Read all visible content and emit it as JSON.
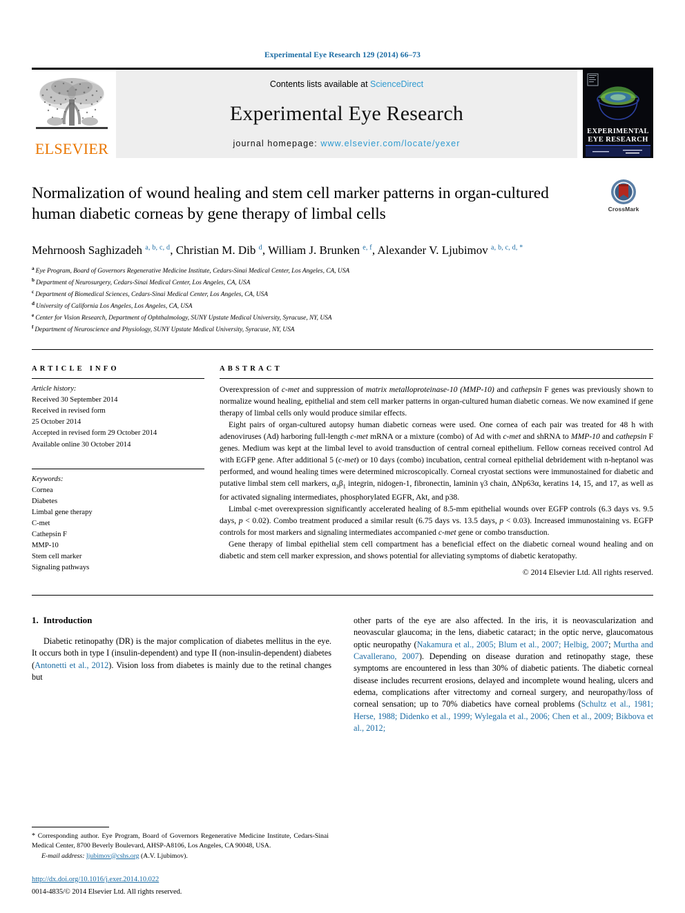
{
  "running_head": "Experimental Eye Research 129 (2014) 66–73",
  "masthead": {
    "elsevier_wordmark": "ELSEVIER",
    "contents_prefix": "Contents lists available at ",
    "contents_link": "ScienceDirect",
    "journal_name": "Experimental Eye Research",
    "homepage_prefix": "journal homepage: ",
    "homepage_url": "www.elsevier.com/locate/yexer",
    "cover_title_line1": "EXPERIMENTAL",
    "cover_title_line2": "EYE RESEARCH"
  },
  "crossmark": {
    "label": "CrossMark"
  },
  "title": "Normalization of wound healing and stem cell marker patterns in organ-cultured human diabetic corneas by gene therapy of limbal cells",
  "authors": [
    {
      "name": "Mehrnoosh Saghizadeh",
      "marks": "a, b, c, d",
      "sep": ", "
    },
    {
      "name": "Christian M. Dib",
      "marks": "d",
      "sep": ", "
    },
    {
      "name": "William J. Brunken",
      "marks": "e, f",
      "sep": ", "
    },
    {
      "name": "Alexander V. Ljubimov",
      "marks": "a, b, c, d,",
      "sep": "",
      "corresponding": "*"
    }
  ],
  "affiliations": [
    {
      "mark": "a",
      "text": "Eye Program, Board of Governors Regenerative Medicine Institute, Cedars-Sinai Medical Center, Los Angeles, CA, USA"
    },
    {
      "mark": "b",
      "text": "Department of Neurosurgery, Cedars-Sinai Medical Center, Los Angeles, CA, USA"
    },
    {
      "mark": "c",
      "text": "Department of Biomedical Sciences, Cedars-Sinai Medical Center, Los Angeles, CA, USA"
    },
    {
      "mark": "d",
      "text": "University of California Los Angeles, Los Angeles, CA, USA"
    },
    {
      "mark": "e",
      "text": "Center for Vision Research, Department of Ophthalmology, SUNY Upstate Medical University, Syracuse, NY, USA"
    },
    {
      "mark": "f",
      "text": "Department of Neuroscience and Physiology, SUNY Upstate Medical University, Syracuse, NY, USA"
    }
  ],
  "article_info": {
    "heading": "ARTICLE INFO",
    "history_title": "Article history:",
    "history": [
      "Received 30 September 2014",
      "Received in revised form",
      "25 October 2014",
      "Accepted in revised form 29 October 2014",
      "Available online 30 October 2014"
    ],
    "keywords_title": "Keywords:",
    "keywords": [
      "Cornea",
      "Diabetes",
      "Limbal gene therapy",
      "C-met",
      "Cathepsin F",
      "MMP-10",
      "Stem cell marker",
      "Signaling pathways"
    ]
  },
  "abstract": {
    "heading": "ABSTRACT",
    "paragraphs": [
      "Overexpression of <i class=\"it\">c-met</i> and suppression of <i class=\"it\">matrix metalloproteinase-10 (MMP-10)</i> and <i class=\"it\">cathepsin</i> F genes was previously shown to normalize wound healing, epithelial and stem cell marker patterns in organ-cultured human diabetic corneas. We now examined if gene therapy of limbal cells only would produce similar effects.",
      "Eight pairs of organ-cultured autopsy human diabetic corneas were used. One cornea of each pair was treated for 48 h with adenoviruses (Ad) harboring full-length <i class=\"it\">c-met</i> mRNA or a mixture (combo) of Ad with <i class=\"it\">c-met</i> and shRNA to <i class=\"it\">MMP-10</i> and <i class=\"it\">cathepsin</i> F genes. Medium was kept at the limbal level to avoid transduction of central corneal epithelium. Fellow corneas received control Ad with EGFP gene. After additional 5 (<i class=\"it\">c-met</i>) or 10 days (combo) incubation, central corneal epithelial debridement with n-heptanol was performed, and wound healing times were determined microscopically. Corneal cryostat sections were immunostained for diabetic and putative limbal stem cell markers, α<sub>3</sub>β<sub>1</sub> integrin, nidogen-1, fibronectin, laminin γ3 chain, ΔNp63α, keratins 14, 15, and 17, as well as for activated signaling intermediates, phosphorylated EGFR, Akt, and p38.",
      "Limbal c-met overexpression significantly accelerated healing of 8.5-mm epithelial wounds over EGFP controls (6.3 days vs. 9.5 days, <i class=\"it\">p</i> &lt; 0.02). Combo treatment produced a similar result (6.75 days vs. 13.5 days, <i class=\"it\">p</i> &lt; 0.03). Increased immunostaining vs. EGFP controls for most markers and signaling intermediates accompanied <i class=\"it\">c-met</i> gene or combo transduction.",
      "Gene therapy of limbal epithelial stem cell compartment has a beneficial effect on the diabetic corneal wound healing and on diabetic and stem cell marker expression, and shows potential for alleviating symptoms of diabetic keratopathy."
    ],
    "copyright": "© 2014 Elsevier Ltd. All rights reserved."
  },
  "introduction": {
    "number": "1.",
    "heading": "Introduction",
    "left_paragraph": "Diabetic retinopathy (DR) is the major complication of diabetes mellitus in the eye. It occurs both in type I (insulin-dependent) and type II (non-insulin-dependent) diabetes (<span class=\"ref\">Antonetti et al., 2012</span>). Vision loss from diabetes is mainly due to the retinal changes but",
    "right_paragraph": "other parts of the eye are also affected. In the iris, it is neovascularization and neovascular glaucoma; in the lens, diabetic cataract; in the optic nerve, glaucomatous optic neuropathy (<span class=\"ref\">Nakamura et al., 2005; Blum et al., 2007; Helbig, 2007</span>; <span class=\"ref\">Murtha and Cavallerano, 2007</span>). Depending on disease duration and retinopathy stage, these symptoms are encountered in less than 30% of diabetic patients. The diabetic corneal disease includes recurrent erosions, delayed and incomplete wound healing, ulcers and edema, complications after vitrectomy and corneal surgery, and neuropathy/loss of corneal sensation; up to 70% diabetics have corneal problems (<span class=\"ref\">Schultz et al., 1981; Herse, 1988; Didenko et al., 1999; Wylegala et al., 2006; Chen et al., 2009; Bikbova et al., 2012;</span>"
  },
  "footnote": {
    "star": "*",
    "corresponding": "Corresponding author. Eye Program, Board of Governors Regenerative Medicine Institute, Cedars-Sinai Medical Center, 8700 Beverly Boulevard, AHSP-A8106, Los Angeles, CA 90048, USA.",
    "email_label": "E-mail address:",
    "email": "ljubimov@cshs.org",
    "email_owner": "(A.V. Ljubimov).",
    "doi": "http://dx.doi.org/10.1016/j.exer.2014.10.022",
    "issn_line": "0014-4835/© 2014 Elsevier Ltd. All rights reserved."
  },
  "colors": {
    "link_blue": "#1a6ba3",
    "science_direct_blue": "#2e9ad0",
    "elsevier_orange": "#EA7600",
    "band_gray": "#eeeeee"
  }
}
